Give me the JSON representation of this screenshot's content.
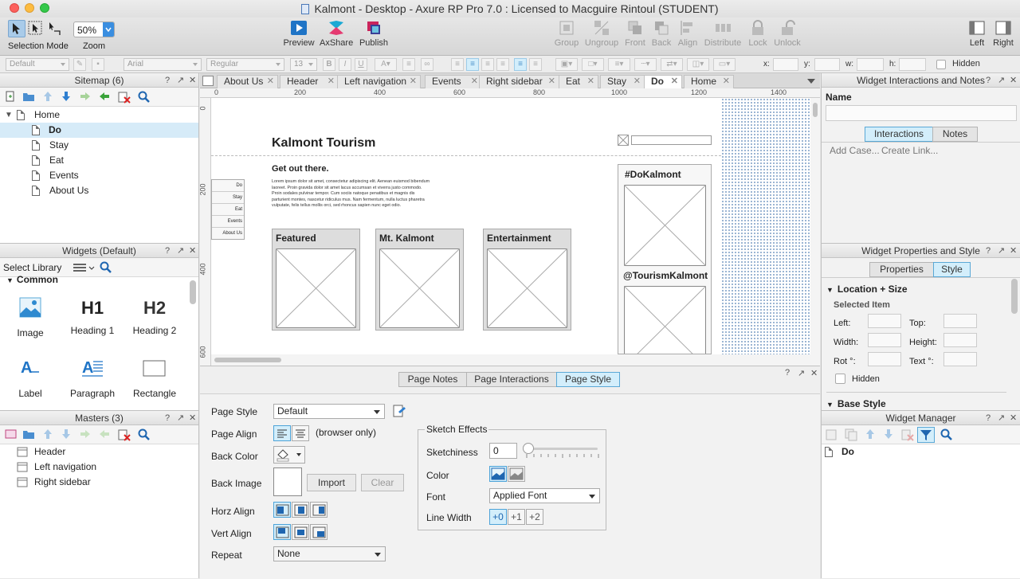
{
  "window": {
    "title": "Kalmont - Desktop - Axure RP Pro 7.0 : Licensed to Macguire Rintoul (STUDENT)"
  },
  "toolbar": {
    "selection_mode": "Selection Mode",
    "zoom_value": "50%",
    "zoom_label": "Zoom",
    "preview": "Preview",
    "axshare": "AxShare",
    "publish": "Publish",
    "group": "Group",
    "ungroup": "Ungroup",
    "front": "Front",
    "back": "Back",
    "align": "Align",
    "distribute": "Distribute",
    "lock": "Lock",
    "unlock": "Unlock",
    "left": "Left",
    "right": "Right"
  },
  "format": {
    "style": "Default",
    "font": "Arial",
    "weight": "Regular",
    "size": "13",
    "bold": "B",
    "italic": "I",
    "underline": "U",
    "x_label": "x:",
    "y_label": "y:",
    "w_label": "w:",
    "h_label": "h:",
    "hidden_label": "Hidden"
  },
  "sitemap": {
    "title": "Sitemap (6)",
    "items": [
      {
        "label": "Home"
      },
      {
        "label": "Do"
      },
      {
        "label": "Stay"
      },
      {
        "label": "Eat"
      },
      {
        "label": "Events"
      },
      {
        "label": "About Us"
      }
    ]
  },
  "widgets": {
    "title": "Widgets (Default)",
    "library": "Select Library",
    "section": "Common",
    "items": [
      {
        "label": "Image"
      },
      {
        "label": "Heading 1",
        "glyph": "H1"
      },
      {
        "label": "Heading 2",
        "glyph": "H2"
      },
      {
        "label": "Label"
      },
      {
        "label": "Paragraph"
      },
      {
        "label": "Rectangle"
      }
    ]
  },
  "masters": {
    "title": "Masters (3)",
    "items": [
      {
        "label": "Header"
      },
      {
        "label": "Left navigation"
      },
      {
        "label": "Right sidebar"
      }
    ]
  },
  "tabs": [
    "About Us",
    "Header",
    "Left navigation",
    "Events",
    "Right sidebar",
    "Eat",
    "Stay",
    "Do",
    "Home"
  ],
  "active_tab": "Do",
  "ruler": {
    "h": [
      "0",
      "200",
      "400",
      "600",
      "800",
      "1000",
      "1200",
      "1400"
    ],
    "v": [
      "0",
      "200",
      "400",
      "600"
    ]
  },
  "page": {
    "site_title": "Kalmont Tourism",
    "headline": "Get out there.",
    "lorem": "Lorem ipsum dolor sit amet, consectetur adipiscing elit. Aenean euismod bibendum laoreet. Proin gravida dolor sit amet lacus accumsan et viverra justo commodo. Proin sodales pulvinar tempor. Cum sociis natoque penatibus et magnis dis parturient montes, nascetur ridiculus mus. Nam fermentum, nulla luctus pharetra vulputate, felis tellus mollis orci, sed rhoncus sapien nunc eget odio.",
    "nav": [
      "Do",
      "Stay",
      "Eat",
      "Events",
      "About Us"
    ],
    "cards": [
      {
        "title": "Featured"
      },
      {
        "title": "Mt. Kalmont"
      },
      {
        "title": "Entertainment"
      }
    ],
    "sidebar_1": "#DoKalmont",
    "sidebar_2": "@TourismKalmont"
  },
  "bottom": {
    "tabs": [
      "Page Notes",
      "Page Interactions",
      "Page Style"
    ],
    "active": "Page Style",
    "page_style_label": "Page Style",
    "page_style_value": "Default",
    "page_align_label": "Page Align",
    "browser_only": "(browser only)",
    "back_color_label": "Back Color",
    "back_image_label": "Back Image",
    "import": "Import",
    "clear": "Clear",
    "horz_align_label": "Horz Align",
    "vert_align_label": "Vert Align",
    "repeat_label": "Repeat",
    "repeat_value": "None",
    "sketch": {
      "title": "Sketch Effects",
      "sketchiness_label": "Sketchiness",
      "sketchiness_value": "0",
      "color_label": "Color",
      "font_label": "Font",
      "font_value": "Applied Font",
      "line_width_label": "Line Width",
      "lw": [
        "+0",
        "+1",
        "+2"
      ]
    }
  },
  "interactions_panel": {
    "title": "Widget Interactions and Notes",
    "name_label": "Name",
    "tabs": [
      "Interactions",
      "Notes"
    ],
    "add_case": "Add Case...",
    "create_link": "Create Link..."
  },
  "props_panel": {
    "title": "Widget Properties and Style",
    "tabs": [
      "Properties",
      "Style"
    ],
    "section": "Location + Size",
    "selected": "Selected Item",
    "left": "Left:",
    "top": "Top:",
    "width": "Width:",
    "height": "Height:",
    "rot": "Rot °:",
    "text": "Text °:",
    "hidden": "Hidden",
    "base_style": "Base Style"
  },
  "manager": {
    "title": "Widget Manager",
    "item": "Do"
  },
  "colors": {
    "accent": "#3a9ad9",
    "selected_row": "#d6ebf8",
    "active_tab_bg": "#d3eefb"
  }
}
